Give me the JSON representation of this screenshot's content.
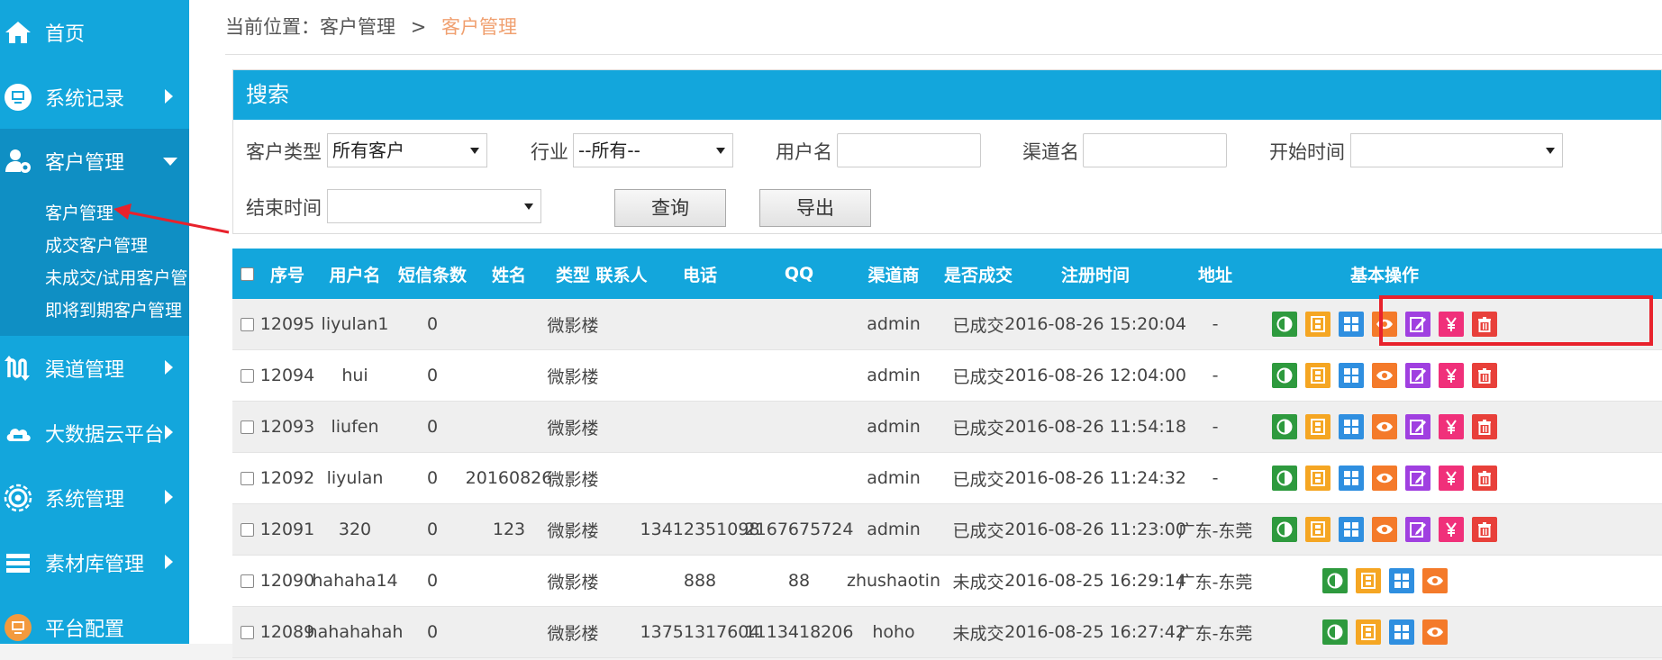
{
  "sidebar": {
    "items": [
      {
        "label": "首页",
        "icon": "home-icon"
      },
      {
        "label": "系统记录",
        "icon": "monitor-icon"
      },
      {
        "label": "客户管理",
        "icon": "user-gear-icon"
      },
      {
        "label": "渠道管理",
        "icon": "channel-icon"
      },
      {
        "label": "大数据云平台",
        "icon": "cloud-icon"
      },
      {
        "label": "系统管理",
        "icon": "gear-icon"
      },
      {
        "label": "素材库管理",
        "icon": "layers-icon"
      },
      {
        "label": "平台配置",
        "icon": "monitor-icon"
      }
    ],
    "submenu": [
      "客户管理",
      "成交客户管理",
      "未成交/试用客户管",
      "即将到期客户管理"
    ]
  },
  "breadcrumb": {
    "prefix": "当前位置：客户管理",
    "sep": ">",
    "current": "客户管理"
  },
  "search": {
    "title": "搜索",
    "customer_type_label": "客户类型",
    "customer_type_value": "所有客户",
    "industry_label": "行业",
    "industry_value": "--所有--",
    "username_label": "用户名",
    "channel_label": "渠道名",
    "start_label": "开始时间",
    "end_label": "结束时间",
    "query_button": "查询",
    "export_button": "导出"
  },
  "table": {
    "headers": {
      "seq": "序号",
      "username": "用户名",
      "sms": "短信条数",
      "name": "姓名",
      "type": "类型",
      "contact": "联系人",
      "phone": "电话",
      "qq": "QQ",
      "channel": "渠道商",
      "deal": "是否成交",
      "reg_time": "注册时间",
      "address": "地址",
      "ops": "基本操作"
    },
    "rows": [
      {
        "seq": "12095",
        "username": "liyulan1",
        "sms": "0",
        "name": "",
        "type": "微影楼",
        "contact": "",
        "phone": "",
        "qq": "",
        "channel": "admin",
        "deal": "已成交",
        "reg_time": "2016-08-26 15:20:04",
        "address": "-",
        "ops": 7
      },
      {
        "seq": "12094",
        "username": "hui",
        "sms": "0",
        "name": "",
        "type": "微影楼",
        "contact": "",
        "phone": "",
        "qq": "",
        "channel": "admin",
        "deal": "已成交",
        "reg_time": "2016-08-26 12:04:00",
        "address": "-",
        "ops": 7
      },
      {
        "seq": "12093",
        "username": "liufen",
        "sms": "0",
        "name": "",
        "type": "微影楼",
        "contact": "",
        "phone": "",
        "qq": "",
        "channel": "admin",
        "deal": "已成交",
        "reg_time": "2016-08-26 11:54:18",
        "address": "-",
        "ops": 7
      },
      {
        "seq": "12092",
        "username": "liyulan",
        "sms": "0",
        "name": "20160826",
        "type": "微影楼",
        "contact": "",
        "phone": "",
        "qq": "",
        "channel": "admin",
        "deal": "已成交",
        "reg_time": "2016-08-26 11:24:32",
        "address": "-",
        "ops": 7
      },
      {
        "seq": "12091",
        "username": "320",
        "sms": "0",
        "name": "123",
        "type": "微影楼",
        "contact": "",
        "phone": "13412351098",
        "qq": "2167675724",
        "channel": "admin",
        "deal": "已成交",
        "reg_time": "2016-08-26 11:23:00",
        "address": "广东-东莞",
        "ops": 7
      },
      {
        "seq": "12090",
        "username": "hahaha14",
        "sms": "0",
        "name": "",
        "type": "微影楼",
        "contact": "",
        "phone": "888",
        "qq": "88",
        "channel": "zhushaotin",
        "deal": "未成交",
        "reg_time": "2016-08-25 16:29:14",
        "address": "广东-东莞",
        "ops": 4
      },
      {
        "seq": "12089",
        "username": "hahahahah",
        "sms": "0",
        "name": "",
        "type": "微影楼",
        "contact": "",
        "phone": "13751317604",
        "qq": "1113418206",
        "channel": "hoho",
        "deal": "未成交",
        "reg_time": "2016-08-25 16:27:42",
        "address": "广东-东莞",
        "ops": 4
      }
    ]
  },
  "ops": [
    {
      "name": "status-toggle-icon",
      "color": "#2e9a3e"
    },
    {
      "name": "film-icon",
      "color": "#f5a623"
    },
    {
      "name": "grid-icon",
      "color": "#2f8fe0"
    },
    {
      "name": "view-eye-icon",
      "color": "#f47a2a"
    },
    {
      "name": "edit-icon",
      "color": "#a040e0"
    },
    {
      "name": "yuan-icon",
      "color": "#f0307a"
    },
    {
      "name": "delete-trash-icon",
      "color": "#e8403a"
    }
  ],
  "colors": {
    "primary": "#13a6dc",
    "active": "#0f8fc4",
    "highlight": "#e8222c",
    "breadcrumb_current": "#f0a070"
  }
}
